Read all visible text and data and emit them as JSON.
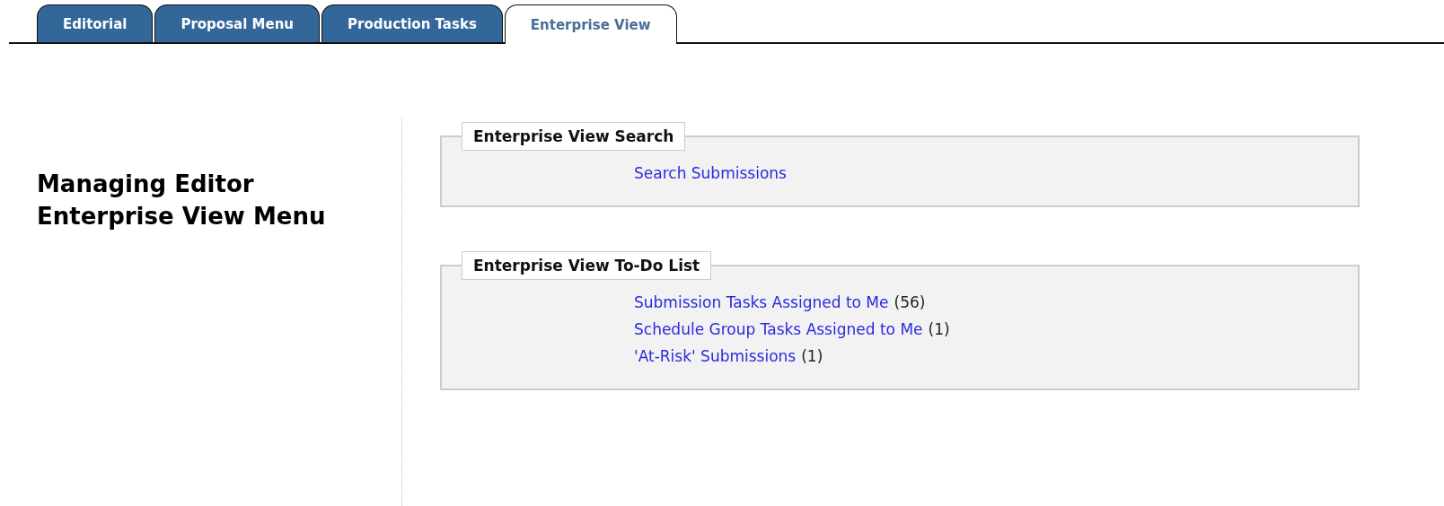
{
  "tabs": [
    {
      "label": "Editorial",
      "selected": false
    },
    {
      "label": "Proposal Menu",
      "selected": false
    },
    {
      "label": "Production Tasks",
      "selected": false
    },
    {
      "label": "Enterprise View",
      "selected": true
    }
  ],
  "menu_title": [
    "Managing Editor",
    "Enterprise View Menu"
  ],
  "sections": [
    {
      "title": "Enterprise View Search",
      "items": [
        {
          "link": "Search Submissions"
        }
      ]
    },
    {
      "title": "Enterprise View To-Do List",
      "items": [
        {
          "link": "Submission Tasks Assigned to Me",
          "count": "(56)"
        },
        {
          "link": "Schedule Group Tasks Assigned to Me",
          "count": "(1)"
        },
        {
          "link": "'At-Risk' Submissions",
          "count": "(1)"
        }
      ]
    }
  ]
}
